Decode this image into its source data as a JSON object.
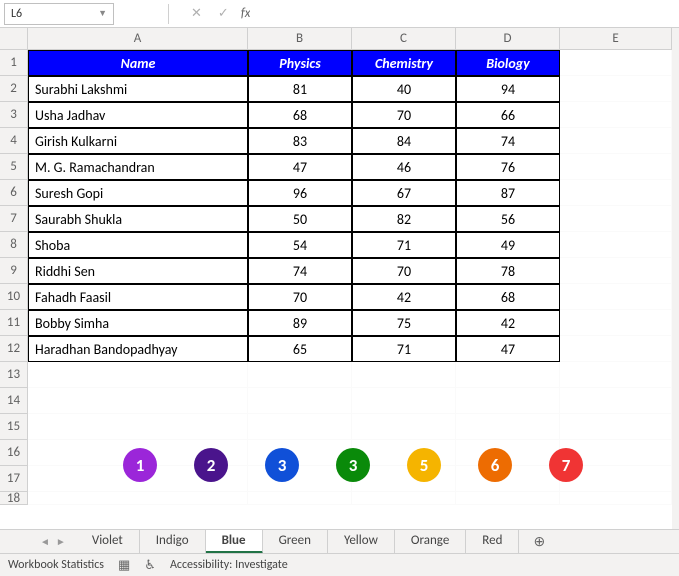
{
  "formula_bar": {
    "name_box": "L6",
    "cancel": "✕",
    "confirm": "✓",
    "fx": "fx",
    "value": ""
  },
  "columns": [
    "A",
    "B",
    "C",
    "D",
    "E"
  ],
  "row_headers": [
    1,
    2,
    3,
    4,
    5,
    6,
    7,
    8,
    9,
    10,
    11,
    12,
    13,
    14,
    15,
    16,
    17,
    18
  ],
  "headers": {
    "name": "Name",
    "physics": "Physics",
    "chemistry": "Chemistry",
    "biology": "Biology"
  },
  "rows": [
    {
      "name": "Surabhi Lakshmi",
      "physics": 81,
      "chemistry": 40,
      "biology": 94
    },
    {
      "name": "Usha Jadhav",
      "physics": 68,
      "chemistry": 70,
      "biology": 66
    },
    {
      "name": "Girish Kulkarni",
      "physics": 83,
      "chemistry": 84,
      "biology": 74
    },
    {
      "name": "M. G. Ramachandran",
      "physics": 47,
      "chemistry": 46,
      "biology": 76
    },
    {
      "name": "Suresh Gopi",
      "physics": 96,
      "chemistry": 67,
      "biology": 87
    },
    {
      "name": "Saurabh Shukla",
      "physics": 50,
      "chemistry": 82,
      "biology": 56
    },
    {
      "name": "Shoba",
      "physics": 54,
      "chemistry": 71,
      "biology": 49
    },
    {
      "name": "Riddhi Sen",
      "physics": 74,
      "chemistry": 70,
      "biology": 78
    },
    {
      "name": "Fahadh Faasil",
      "physics": 70,
      "chemistry": 42,
      "biology": 68
    },
    {
      "name": "Bobby Simha",
      "physics": 89,
      "chemistry": 75,
      "biology": 42
    },
    {
      "name": "Haradhan Bandopadhyay",
      "physics": 65,
      "chemistry": 71,
      "biology": 47
    }
  ],
  "badges": [
    {
      "label": "1",
      "color": "#9b26d9"
    },
    {
      "label": "2",
      "color": "#4a148c"
    },
    {
      "label": "3",
      "color": "#1050d8"
    },
    {
      "label": "3",
      "color": "#0a8a0a"
    },
    {
      "label": "5",
      "color": "#f5b400"
    },
    {
      "label": "6",
      "color": "#ed6c02"
    },
    {
      "label": "7",
      "color": "#f03434"
    }
  ],
  "tabs": {
    "items": [
      {
        "label": "Violet",
        "active": false
      },
      {
        "label": "Indigo",
        "active": false
      },
      {
        "label": "Blue",
        "active": true
      },
      {
        "label": "Green",
        "active": false
      },
      {
        "label": "Yellow",
        "active": false
      },
      {
        "label": "Orange",
        "active": false
      },
      {
        "label": "Red",
        "active": false
      }
    ],
    "add": "⊕"
  },
  "status": {
    "stats": "Workbook Statistics",
    "accessibility": "Accessibility: Investigate"
  }
}
